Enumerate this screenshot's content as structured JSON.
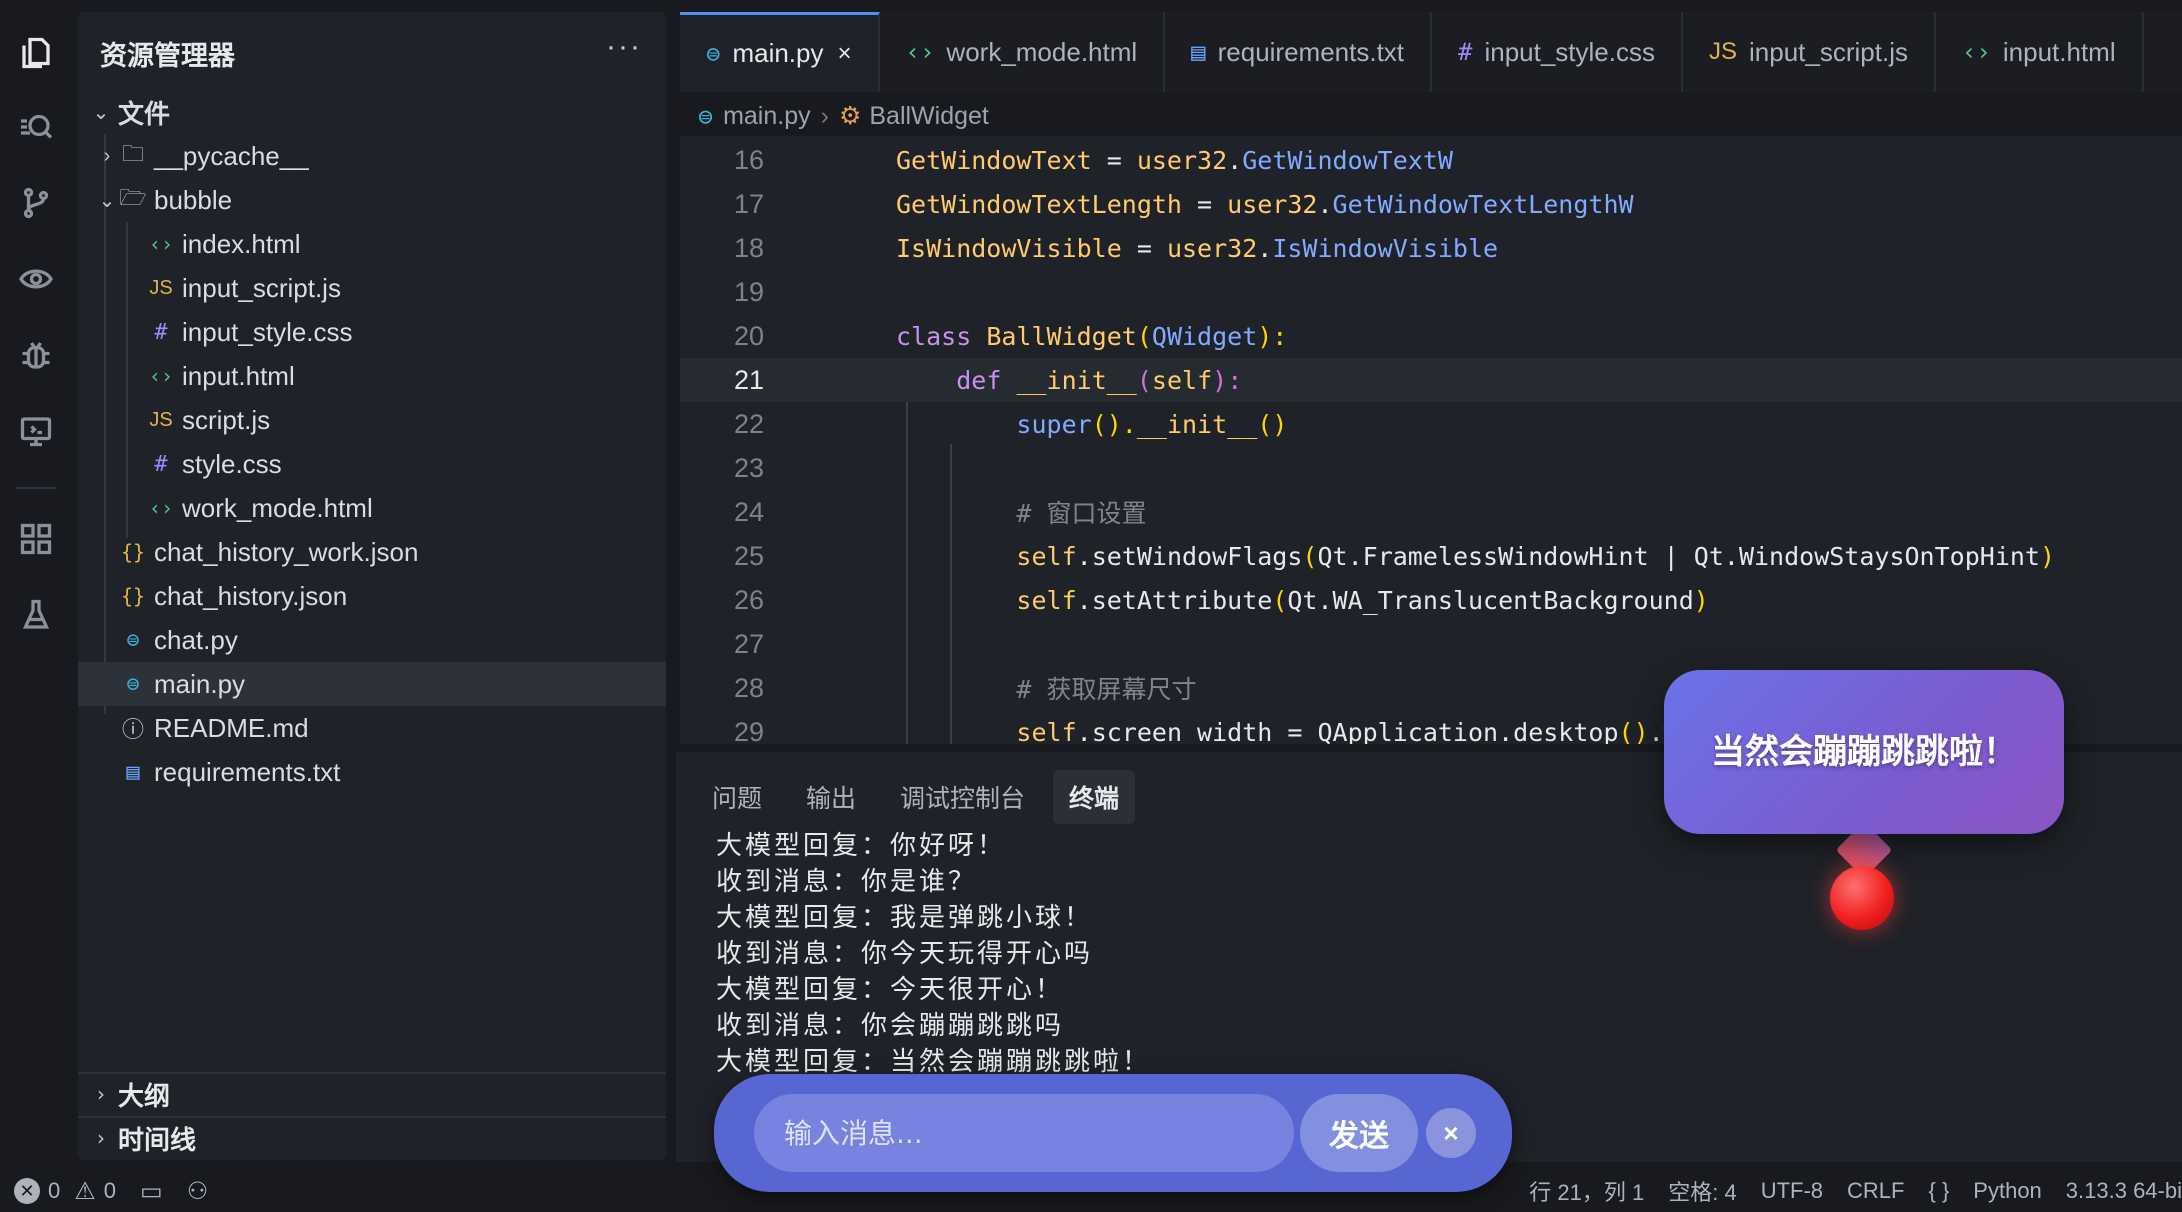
{
  "activity_bar": {
    "items": [
      "explorer-icon",
      "search-icon",
      "source-control-icon",
      "preview-icon",
      "debug-icon",
      "remote-icon",
      "extensions-icon",
      "testing-icon"
    ]
  },
  "explorer": {
    "title": "资源管理器",
    "more": "···",
    "folder_root": "文件",
    "items": [
      {
        "label": "__pycache__",
        "type": "folder"
      },
      {
        "label": "bubble",
        "type": "folder-open"
      },
      {
        "label": "index.html",
        "type": "html"
      },
      {
        "label": "input_script.js",
        "type": "js"
      },
      {
        "label": "input_style.css",
        "type": "css"
      },
      {
        "label": "input.html",
        "type": "html"
      },
      {
        "label": "script.js",
        "type": "js"
      },
      {
        "label": "style.css",
        "type": "css"
      },
      {
        "label": "work_mode.html",
        "type": "html"
      },
      {
        "label": "chat_history_work.json",
        "type": "json"
      },
      {
        "label": "chat_history.json",
        "type": "json"
      },
      {
        "label": "chat.py",
        "type": "py"
      },
      {
        "label": "main.py",
        "type": "py"
      },
      {
        "label": "README.md",
        "type": "info"
      },
      {
        "label": "requirements.txt",
        "type": "txt"
      }
    ],
    "outline": "大纲",
    "timeline": "时间线"
  },
  "tabs": [
    {
      "label": "main.py",
      "icon": "⊜"
    },
    {
      "label": "work_mode.html",
      "icon": "‹›"
    },
    {
      "label": "requirements.txt",
      "icon": "▤"
    },
    {
      "label": "input_style.css",
      "icon": "#"
    },
    {
      "label": "input_script.js",
      "icon": "JS"
    },
    {
      "label": "input.html",
      "icon": "‹›"
    }
  ],
  "tab_close": "×",
  "breadcrumb": {
    "file": "main.py",
    "symbol": "BallWidget"
  },
  "code": {
    "line_numbers": [
      "16",
      "17",
      "18",
      "19",
      "20",
      "21",
      "22",
      "23",
      "24",
      "25",
      "26",
      "27",
      "28",
      "29"
    ],
    "l16a": "GetWindowText",
    "l16b": " = ",
    "l16c": "user32",
    "l16d": ".",
    "l16e": "GetWindowTextW",
    "l17a": "GetWindowTextLength",
    "l17b": " = ",
    "l17c": "user32",
    "l17d": ".",
    "l17e": "GetWindowTextLengthW",
    "l18a": "IsWindowVisible",
    "l18b": " = ",
    "l18c": "user32",
    "l18d": ".",
    "l18e": "IsWindowVisible",
    "l20a": "class ",
    "l20b": "BallWidget",
    "l20c": "(",
    "l20d": "QWidget",
    "l20e": "):",
    "l21a": "def ",
    "l21b": "__init__",
    "l21c": "(",
    "l21d": "self",
    "l21e": "):",
    "l22a": "super",
    "l22b": "().",
    "l22c": "__init__",
    "l22d": "()",
    "l24": "# 窗口设置",
    "l25a": "self",
    "l25b": ".setWindowFlags",
    "l25c": "(",
    "l25d": "Qt",
    "l25e": ".FramelessWindowHint | ",
    "l25f": "Qt",
    "l25g": ".WindowStaysOnTopHint",
    "l25h": ")",
    "l26a": "self",
    "l26b": ".setAttribute",
    "l26c": "(",
    "l26d": "Qt",
    "l26e": ".WA_TranslucentBackground",
    "l26f": ")",
    "l28": "# 获取屏幕尺寸",
    "l29a": "self",
    "l29b": ".screen_width = ",
    "l29c": "QApplication",
    "l29d": ".desktop",
    "l29e": "()",
    "l29f": ".wid"
  },
  "panel": {
    "tabs": [
      "问题",
      "输出",
      "调试控制台",
      "终端"
    ],
    "terminal_lines": [
      "大模型回复：你好呀！",
      "收到消息：你是谁？",
      "大模型回复：我是弹跳小球！",
      "收到消息：你今天玩得开心吗",
      "大模型回复：今天很开心！",
      "收到消息：你会蹦蹦跳跳吗",
      "大模型回复：当然会蹦蹦跳跳啦！"
    ]
  },
  "status": {
    "errors": "0",
    "warnings": "0",
    "position": "行 21，列 1",
    "spaces": "空格: 4",
    "encoding": "UTF-8",
    "eol": "CRLF",
    "braces": "{ }",
    "language": "Python",
    "interpreter": "3.13.3 64-bi"
  },
  "bubble": {
    "text": "当然会蹦蹦跳跳啦！"
  },
  "chat": {
    "placeholder": "输入消息...",
    "send_label": "发送",
    "close_label": "×"
  }
}
